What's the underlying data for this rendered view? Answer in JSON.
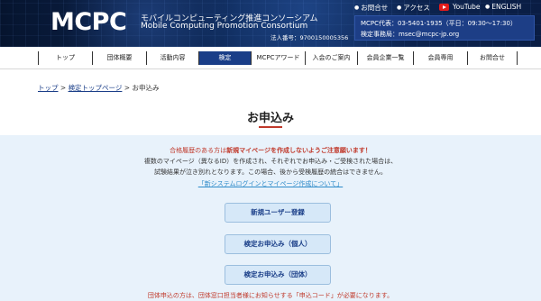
{
  "header": {
    "logo": "MCPC",
    "org_jp": "モバイルコンピューティング推進コンソーシアム",
    "org_en": "Mobile Computing Promotion Consortium",
    "corp_no": "法人番号：9700150005356",
    "util": {
      "inquiry": "お問合せ",
      "access": "アクセス",
      "youtube": "YouTube",
      "english": "ENGLISH"
    },
    "contact": {
      "rep": "MCPC代表：03-5401-1935（平日：09:30～17:30）",
      "exam": "検定事務局：msec@mcpc-jp.org"
    }
  },
  "nav": {
    "items": [
      {
        "label": "トップ"
      },
      {
        "label": "団体概要"
      },
      {
        "label": "活動内容"
      },
      {
        "label": "検定"
      },
      {
        "label": "MCPCアワード"
      },
      {
        "label": "入会のご案内"
      },
      {
        "label": "会員企業一覧"
      },
      {
        "label": "会員専用"
      },
      {
        "label": "お問合せ"
      }
    ]
  },
  "breadcrumb": {
    "top": "トップ",
    "sep1": " > ",
    "exam_top": "検定トップページ",
    "sep2": " > ",
    "current": "お申込み"
  },
  "page": {
    "title": "お申込み",
    "notice_red_prefix": "合格履歴のある方は",
    "notice_red_bold": "新規マイページを作成しないようご注意願います！",
    "notice_line1": "複数のマイページ（異なるID）を作成され、それぞれでお申込み・ご受検された場合は、",
    "notice_line2": "試験結果が泣き別れとなります。この場合、後から受検履歴の統合はできません。",
    "notice_link": "「新システムログインとマイページ作成について」",
    "buttons": {
      "new_user": "新規ユーザー登録",
      "apply_individual": "検定お申込み（個人）",
      "apply_group": "検定お申込み（団体）"
    },
    "bottom_note": "団体申込の方は、団体窓口担当者様にお知らせする「申込コード」が必要になります。"
  },
  "colors": {
    "header_bg": "#0b1a3a",
    "nav_active": "#1a3e88",
    "accent_red": "#c0392b",
    "content_bg": "#e8f2fb",
    "button_bg": "#d6e8f8"
  }
}
